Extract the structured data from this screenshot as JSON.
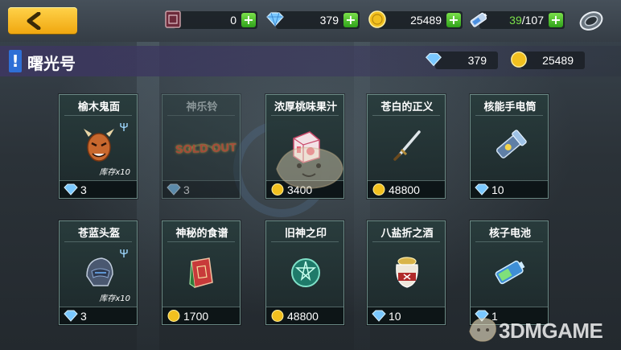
{
  "header": {
    "back_icon": "chevron-left-icon",
    "resources": [
      {
        "icon": "ticket-icon",
        "value": "0"
      },
      {
        "icon": "diamond-icon",
        "value": "379"
      },
      {
        "icon": "coin-icon",
        "value": "25489"
      },
      {
        "icon": "battery-icon",
        "value_current": "39",
        "value_max": "/107"
      }
    ],
    "settings_icon": "ring-icon"
  },
  "shop": {
    "title": "曙光号",
    "diamonds": "379",
    "coins": "25489"
  },
  "items": [
    {
      "name": "榆木鬼面",
      "price": "3",
      "currency": "diamond",
      "stock": "库存x10",
      "art": "oni-mask-icon",
      "sold_out": false
    },
    {
      "name": "神乐铃",
      "price": "3",
      "currency": "diamond",
      "stock": "",
      "art": "bell-icon",
      "sold_out": true,
      "sold_out_label": "SOLD OUT"
    },
    {
      "name": "浓厚桃味果汁",
      "price": "3400",
      "currency": "coin",
      "stock": "",
      "art": "juice-box-icon",
      "sold_out": false
    },
    {
      "name": "苍白的正义",
      "price": "48800",
      "currency": "coin",
      "stock": "",
      "art": "sword-icon",
      "sold_out": false
    },
    {
      "name": "核能手电筒",
      "price": "10",
      "currency": "diamond",
      "stock": "",
      "art": "flashlight-icon",
      "sold_out": false
    },
    {
      "name": "苍蓝头盔",
      "price": "3",
      "currency": "diamond",
      "stock": "库存x10",
      "art": "helmet-icon",
      "sold_out": false
    },
    {
      "name": "神秘的食谱",
      "price": "1700",
      "currency": "coin",
      "stock": "",
      "art": "book-icon",
      "sold_out": false
    },
    {
      "name": "旧神之印",
      "price": "48800",
      "currency": "coin",
      "stock": "",
      "art": "seal-icon",
      "sold_out": false
    },
    {
      "name": "八盐折之酒",
      "price": "10",
      "currency": "diamond",
      "stock": "",
      "art": "sake-jar-icon",
      "sold_out": false
    },
    {
      "name": "核子电池",
      "price": "1",
      "currency": "diamond",
      "stock": "",
      "art": "battery-cell-icon",
      "sold_out": false
    }
  ],
  "watermark": "3DMGAME",
  "colors": {
    "accent_yellow": "#f0a70f",
    "plus_green": "#2fa21a",
    "title_blue": "#2f6fd6",
    "soldout_red": "#ff4a2a"
  }
}
